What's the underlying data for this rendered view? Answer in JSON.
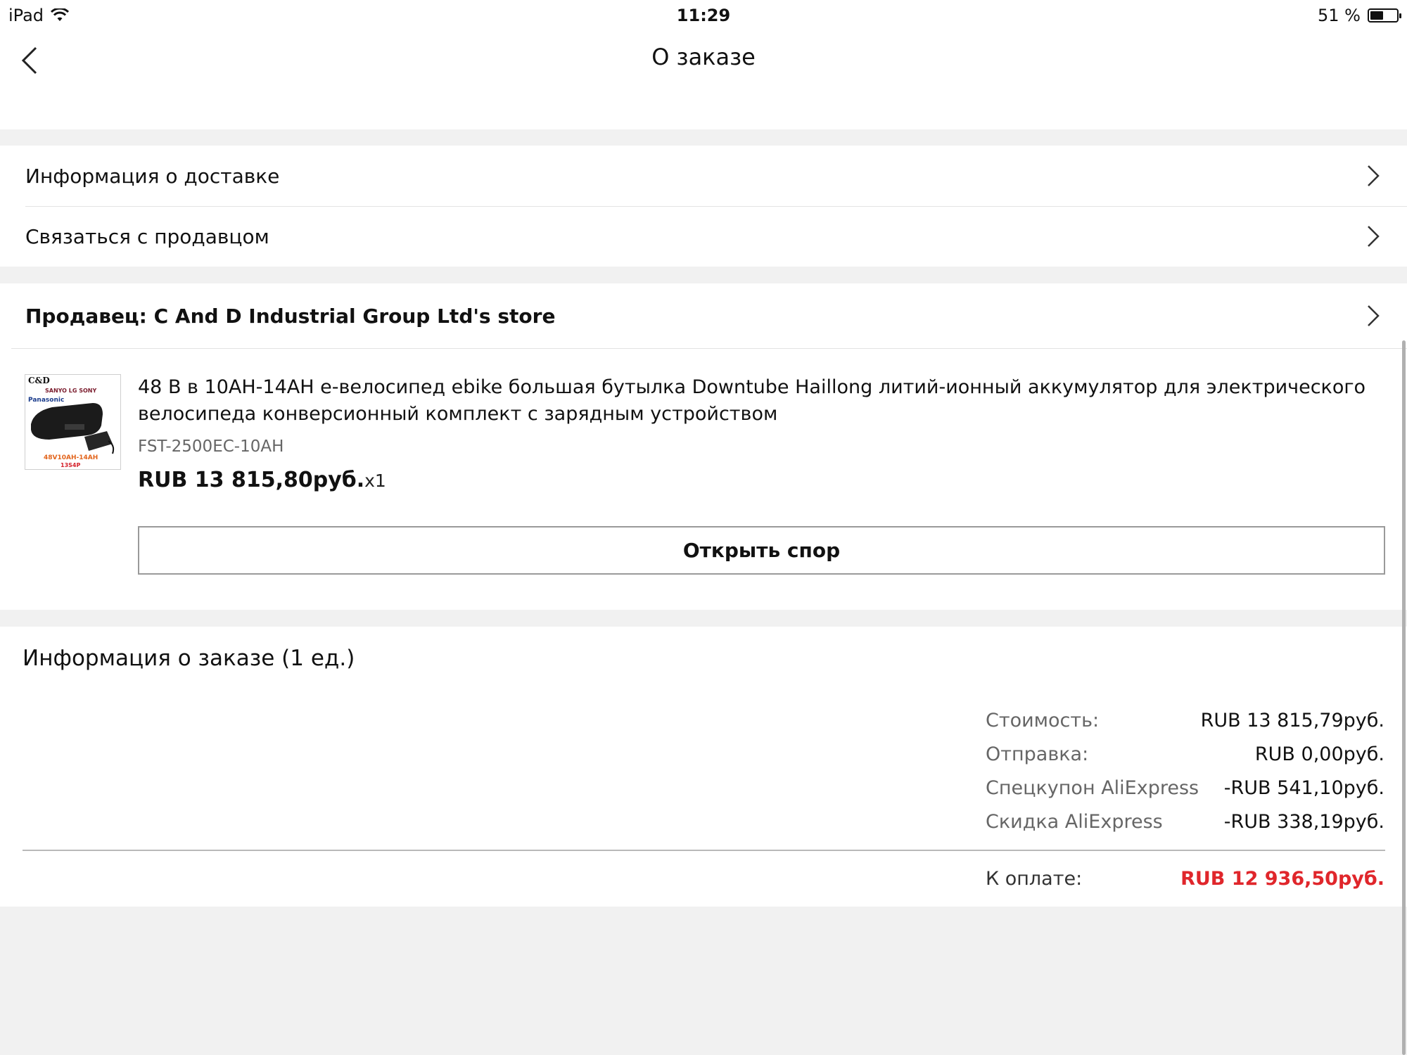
{
  "status_bar": {
    "device": "iPad",
    "time": "11:29",
    "battery_text": "51 %",
    "battery_level": 0.51
  },
  "nav": {
    "title": "О заказе"
  },
  "menu": {
    "delivery_info": "Информация о доставке",
    "contact_seller": "Связаться с продавцом"
  },
  "seller": {
    "label": "Продавец: C And D Industrial Group Ltd's store"
  },
  "product": {
    "title": "48 В в 10AH-14AH e-велосипед ebike большая бутылка Downtube Haillong литий-ионный аккумулятор для электрического велосипеда конверсионный комплект с зарядным устройством",
    "sku": "FST-2500EC-10AH",
    "price": "RUB 13 815,80руб.",
    "quantity": "x1",
    "image_brand": "C&D",
    "image_logos": "SANYO LG SONY",
    "image_panasonic": "Panasonic",
    "image_caption_1": "48V10AH-14AH",
    "image_caption_2": "13S4P"
  },
  "dispute_button": "Открыть спор",
  "order_info": {
    "title": "Информация о заказе (1 ед.)",
    "rows": [
      {
        "label": "Стоимость:",
        "value": "RUB 13 815,79руб."
      },
      {
        "label": "Отправка:",
        "value": "RUB 0,00руб."
      },
      {
        "label": "Спецкупон AliExpress",
        "value": "-RUB 541,10руб."
      },
      {
        "label": "Скидка AliExpress",
        "value": "-RUB 338,19руб."
      }
    ],
    "total_label": "К оплате:",
    "total_value": "RUB 12 936,50руб."
  },
  "colors": {
    "accent_total": "#e0262b",
    "background": "#f1f1f1"
  }
}
